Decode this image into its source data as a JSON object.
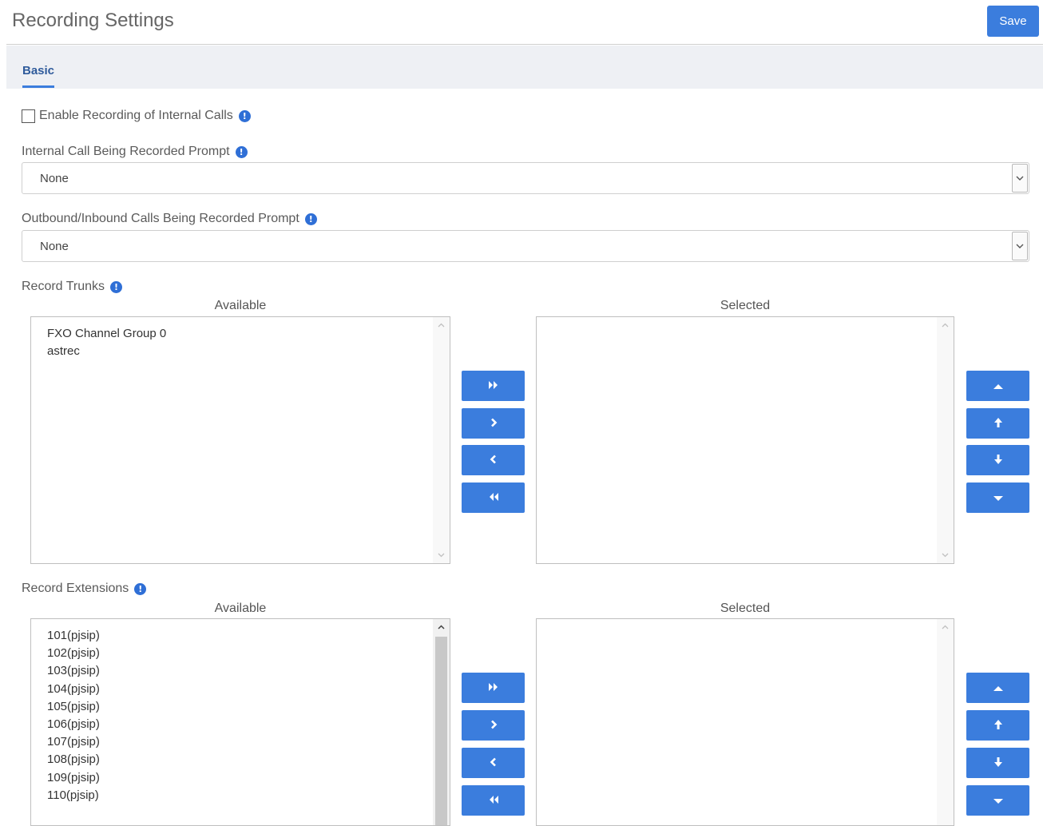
{
  "header": {
    "title": "Recording Settings",
    "save_label": "Save"
  },
  "tabs": [
    {
      "label": "Basic",
      "active": true
    }
  ],
  "form": {
    "enable_internal": {
      "label": "Enable Recording of Internal Calls",
      "checked": false
    },
    "internal_prompt": {
      "label": "Internal Call Being Recorded Prompt",
      "value": "None"
    },
    "outbound_prompt": {
      "label": "Outbound/Inbound Calls Being Recorded Prompt",
      "value": "None"
    },
    "info_glyph": "!"
  },
  "record_trunks": {
    "label": "Record Trunks",
    "available_label": "Available",
    "selected_label": "Selected",
    "available": [
      "FXO Channel Group 0",
      "astrec"
    ],
    "selected": []
  },
  "record_extensions": {
    "label": "Record Extensions",
    "available_label": "Available",
    "selected_label": "Selected",
    "available": [
      "101(pjsip)",
      "102(pjsip)",
      "103(pjsip)",
      "104(pjsip)",
      "105(pjsip)",
      "106(pjsip)",
      "107(pjsip)",
      "108(pjsip)",
      "109(pjsip)",
      "110(pjsip)"
    ],
    "selected": []
  },
  "icons": {
    "move_all_right": "double-chevron-right-icon",
    "move_right": "chevron-right-icon",
    "move_left": "chevron-left-icon",
    "move_all_left": "double-chevron-left-icon",
    "move_top": "caret-up-icon",
    "move_up": "arrow-up-icon",
    "move_down": "arrow-down-icon",
    "move_bottom": "caret-down-icon"
  },
  "colors": {
    "primary": "#3b7ddd",
    "tab_bar": "#eef0f4",
    "info": "#2f6fd6"
  }
}
